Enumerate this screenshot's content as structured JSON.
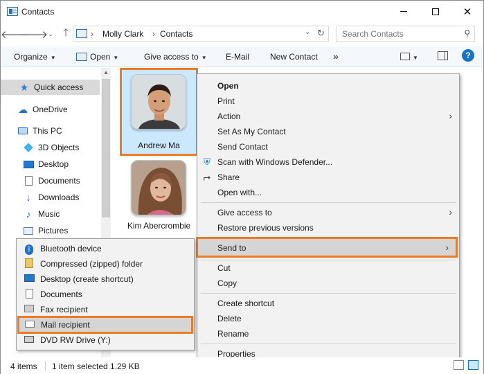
{
  "window": {
    "title": "Contacts"
  },
  "nav": {
    "breadcrumb": [
      "Molly Clark",
      "Contacts"
    ],
    "search_placeholder": "Search Contacts"
  },
  "toolbar": {
    "organize": "Organize",
    "open": "Open",
    "give_access": "Give access to",
    "email": "E-Mail",
    "new_contact": "New Contact",
    "more": "»"
  },
  "sidebar": {
    "items": [
      {
        "label": "Quick access",
        "icon": "star-icon"
      },
      {
        "label": "OneDrive",
        "icon": "cloud-icon"
      },
      {
        "label": "This PC",
        "icon": "computer-icon"
      },
      {
        "label": "3D Objects",
        "icon": "cube-icon"
      },
      {
        "label": "Desktop",
        "icon": "desktop-icon"
      },
      {
        "label": "Documents",
        "icon": "document-icon"
      },
      {
        "label": "Downloads",
        "icon": "download-icon"
      },
      {
        "label": "Music",
        "icon": "music-icon"
      },
      {
        "label": "Pictures",
        "icon": "pictures-icon"
      }
    ]
  },
  "contacts": [
    {
      "name": "Andrew Ma"
    },
    {
      "name": "Kim Abercrombie"
    }
  ],
  "context_menu": {
    "items": [
      "Open",
      "Print",
      "Action",
      "Set As My Contact",
      "Send Contact",
      "Scan with Windows Defender...",
      "Share",
      "Open with...",
      "Give access to",
      "Restore previous versions",
      "Send to",
      "Cut",
      "Copy",
      "Create shortcut",
      "Delete",
      "Rename",
      "Properties"
    ]
  },
  "send_to": {
    "items": [
      "Bluetooth device",
      "Compressed (zipped) folder",
      "Desktop (create shortcut)",
      "Documents",
      "Fax recipient",
      "Mail recipient",
      "DVD RW Drive (Y:)"
    ]
  },
  "status": {
    "items_count": "4 items",
    "selected": "1 item selected",
    "size": "1.29 KB"
  },
  "colors": {
    "highlight": "#ee7a26",
    "selection": "#cce8ff",
    "accent": "#1673c7"
  }
}
